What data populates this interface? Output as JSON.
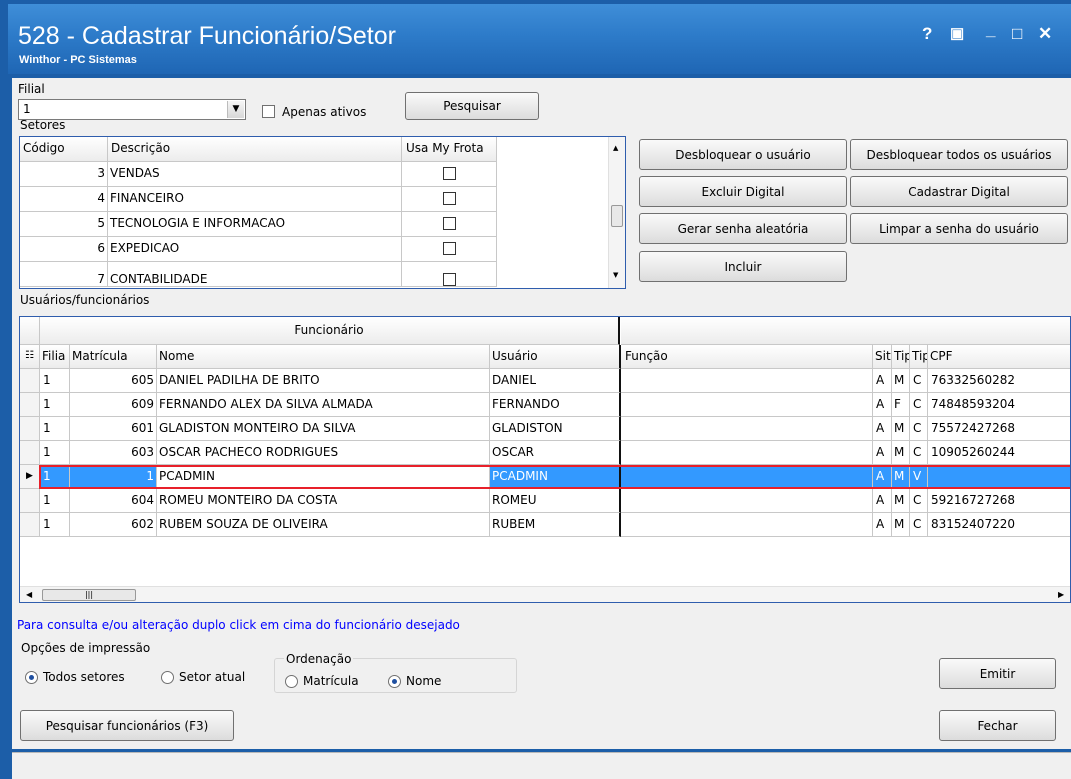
{
  "window": {
    "title": "528 - Cadastrar Funcionário/Setor",
    "subtitle": "Winthor - PC Sistemas",
    "controls": {
      "help": "?",
      "restore": "▣",
      "minimize": "_",
      "maximize": "□",
      "close": "✕"
    }
  },
  "filial": {
    "label": "Filial",
    "value": "1",
    "apenas_ativos": "Apenas ativos",
    "pesquisar": "Pesquisar"
  },
  "setores": {
    "label": "Setores",
    "columns": [
      "Código",
      "Descrição",
      "Usa My Frota"
    ],
    "rows": [
      {
        "codigo": "3",
        "descricao": "VENDAS"
      },
      {
        "codigo": "4",
        "descricao": "FINANCEIRO"
      },
      {
        "codigo": "5",
        "descricao": "TECNOLOGIA E INFORMACAO"
      },
      {
        "codigo": "6",
        "descricao": "EXPEDICAO"
      },
      {
        "codigo": "7",
        "descricao": "CONTABILIDADE"
      }
    ]
  },
  "actions": {
    "desbloquear": "Desbloquear o usuário",
    "desbloquear_todos": "Desbloquear todos os usuários",
    "excluir_digital": "Excluir Digital",
    "cadastrar_digital": "Cadastrar Digital",
    "gerar_senha": "Gerar senha aleatória",
    "limpar_senha": "Limpar a senha do usuário",
    "incluir": "Incluir"
  },
  "usuarios": {
    "label": "Usuários/funcionários",
    "band": "Funcionário",
    "columns": [
      "Filia",
      "Matrícula",
      "Nome",
      "Usuário",
      "Função",
      "Sitι",
      "Tip",
      "Tip",
      "CPF"
    ],
    "rows": [
      {
        "filial": "1",
        "matricula": "605",
        "nome": "DANIEL PADILHA DE BRITO",
        "usuario": "DANIEL",
        "funcao": "",
        "sit": "A",
        "tip1": "M",
        "tip2": "C",
        "cpf": "76332560282"
      },
      {
        "filial": "1",
        "matricula": "609",
        "nome": "FERNANDO ALEX DA SILVA ALMADA",
        "usuario": "FERNANDO",
        "funcao": "",
        "sit": "A",
        "tip1": "F",
        "tip2": "C",
        "cpf": "74848593204"
      },
      {
        "filial": "1",
        "matricula": "601",
        "nome": "GLADISTON MONTEIRO DA SILVA",
        "usuario": "GLADISTON",
        "funcao": "",
        "sit": "A",
        "tip1": "M",
        "tip2": "C",
        "cpf": "75572427268"
      },
      {
        "filial": "1",
        "matricula": "603",
        "nome": "OSCAR PACHECO RODRIGUES",
        "usuario": "OSCAR",
        "funcao": "",
        "sit": "A",
        "tip1": "M",
        "tip2": "C",
        "cpf": "10905260244"
      },
      {
        "filial": "1",
        "matricula": "1",
        "nome": "PCADMIN",
        "usuario": "PCADMIN",
        "funcao": "",
        "sit": "A",
        "tip1": "M",
        "tip2": "V",
        "cpf": ""
      },
      {
        "filial": "1",
        "matricula": "604",
        "nome": "ROMEU MONTEIRO DA COSTA",
        "usuario": "ROMEU",
        "funcao": "",
        "sit": "A",
        "tip1": "M",
        "tip2": "C",
        "cpf": "59216727268"
      },
      {
        "filial": "1",
        "matricula": "602",
        "nome": "RUBEM SOUZA DE OLIVEIRA",
        "usuario": "RUBEM",
        "funcao": "",
        "sit": "A",
        "tip1": "M",
        "tip2": "C",
        "cpf": "83152407220"
      }
    ],
    "selected_row": "PCADMIN"
  },
  "hint": "Para consulta e/ou alteração duplo click em cima do funcionário desejado",
  "impressao": {
    "label": "Opções de impressão",
    "todos_setores": "Todos setores",
    "setor_atual": "Setor atual",
    "ordenacao_label": "Ordenação",
    "matricula": "Matrícula",
    "nome": "Nome"
  },
  "footer": {
    "emitir": "Emitir",
    "pesquisar_func": "Pesquisar funcionários (F3)",
    "fechar": "Fechar"
  },
  "colors": {
    "titlebar": "#2d7bc9",
    "selection": "#3399ff",
    "hint_text": "#0000ff"
  }
}
